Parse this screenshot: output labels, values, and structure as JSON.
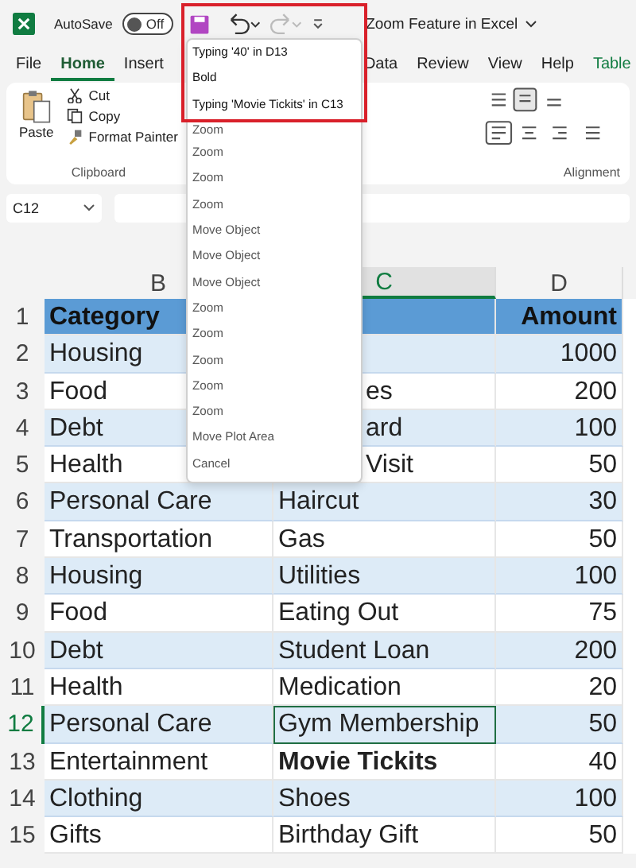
{
  "titlebar": {
    "autosave_label": "AutoSave",
    "autosave": {
      "label": "Off",
      "on": false
    },
    "title": "Zoom Feature in Excel"
  },
  "tabs": [
    {
      "label": "File",
      "selected": false
    },
    {
      "label": "Home",
      "selected": true
    },
    {
      "label": "Insert",
      "selected": false
    },
    {
      "label": "Data",
      "selected": false
    },
    {
      "label": "Review",
      "selected": false
    },
    {
      "label": "View",
      "selected": false
    },
    {
      "label": "Help",
      "selected": false
    },
    {
      "label": "Table",
      "selected": false
    }
  ],
  "ribbon": {
    "paste": "Paste",
    "cut": "Cut",
    "copy": "Copy",
    "format_painter": "Format Painter",
    "clipboard_group": "Clipboard",
    "alignment_group": "Alignment"
  },
  "name_box": "C12",
  "columns": [
    "B",
    "C",
    "D"
  ],
  "header": {
    "num": "1",
    "category": "Category",
    "amount": "Amount"
  },
  "rows": [
    {
      "num": "2",
      "category": "Housing",
      "amount": "1000",
      "selected": false
    },
    {
      "num": "3",
      "category": "Food",
      "item": {
        "text": "es",
        "bold": false
      },
      "amount": "200",
      "selected": false
    },
    {
      "num": "4",
      "category": "Debt",
      "item": {
        "text": "ard",
        "bold": false
      },
      "amount": "100",
      "selected": false
    },
    {
      "num": "5",
      "category": "Health",
      "item": {
        "text": "Visit",
        "bold": false
      },
      "amount": "50",
      "selected": false
    },
    {
      "num": "6",
      "category": "Personal Care",
      "item": {
        "text": "Haircut",
        "bold": false
      },
      "amount": "30",
      "selected": false
    },
    {
      "num": "7",
      "category": "Transportation",
      "item": {
        "text": "Gas",
        "bold": false
      },
      "amount": "50",
      "selected": false
    },
    {
      "num": "8",
      "category": "Housing",
      "item": {
        "text": "Utilities",
        "bold": false
      },
      "amount": "100",
      "selected": false
    },
    {
      "num": "9",
      "category": "Food",
      "item": {
        "text": "Eating Out",
        "bold": false
      },
      "amount": "75",
      "selected": false
    },
    {
      "num": "10",
      "category": "Debt",
      "item": {
        "text": "Student Loan",
        "bold": false
      },
      "amount": "200",
      "selected": false
    },
    {
      "num": "11",
      "category": "Health",
      "item": {
        "text": "Medication",
        "bold": false
      },
      "amount": "20",
      "selected": false
    },
    {
      "num": "12",
      "category": "Personal Care",
      "item": {
        "text": "Gym Membership",
        "bold": false
      },
      "amount": "50",
      "selected": true
    },
    {
      "num": "13",
      "category": "Entertainment",
      "item": {
        "text": "Movie Tickits",
        "bold": true
      },
      "amount": "40",
      "selected": false
    },
    {
      "num": "14",
      "category": "Clothing",
      "item": {
        "text": "Shoes",
        "bold": false
      },
      "amount": "100",
      "selected": false
    },
    {
      "num": "15",
      "category": "Gifts",
      "item": {
        "text": "Birthday Gift",
        "bold": false
      },
      "amount": "50",
      "selected": false
    }
  ],
  "undo_menu": [
    {
      "label": "Typing '40' in D13",
      "marked": true
    },
    {
      "label": "Bold",
      "marked": true
    },
    {
      "label": "Typing 'Movie Tickits' in C13",
      "marked": true
    },
    {
      "label": "Zoom",
      "marked": false
    },
    {
      "label": "Zoom",
      "marked": false
    },
    {
      "label": "Zoom",
      "marked": false
    },
    {
      "label": "Zoom",
      "marked": false
    },
    {
      "label": "Move Object",
      "marked": false
    },
    {
      "label": "Move Object",
      "marked": false
    },
    {
      "label": "Move Object",
      "marked": false
    },
    {
      "label": "Zoom",
      "marked": false
    },
    {
      "label": "Zoom",
      "marked": false
    },
    {
      "label": "Zoom",
      "marked": false
    },
    {
      "label": "Zoom",
      "marked": false
    },
    {
      "label": "Zoom",
      "marked": false
    },
    {
      "label": "Move Plot Area",
      "marked": false
    },
    {
      "label": "Cancel",
      "marked": false
    }
  ]
}
